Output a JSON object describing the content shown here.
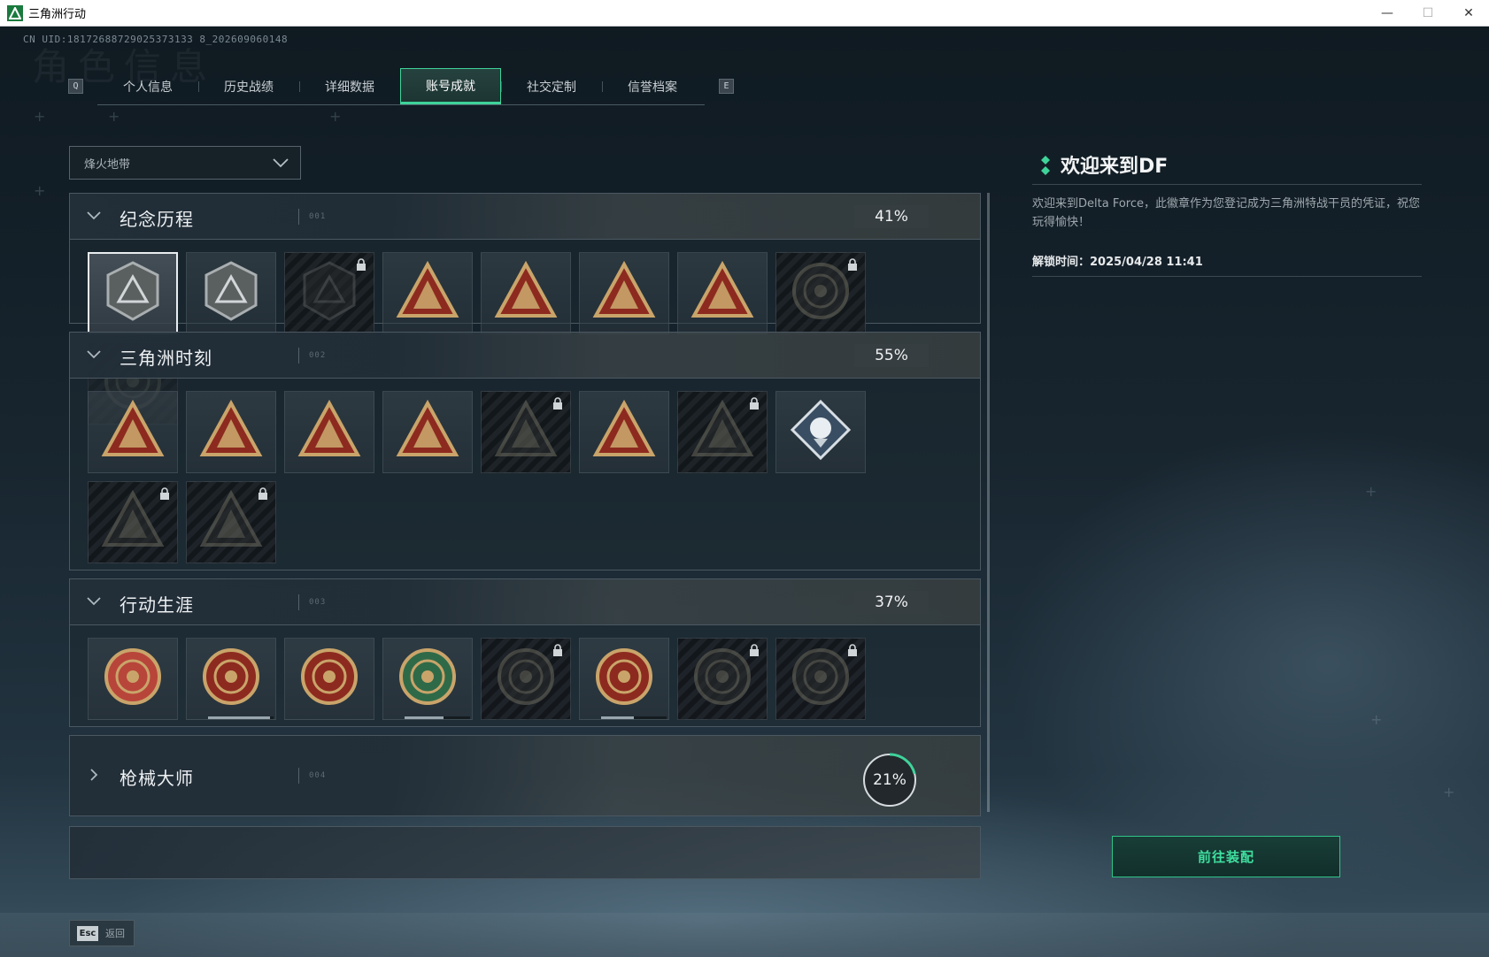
{
  "window": {
    "title": "三角洲行动",
    "minimize": "—",
    "maximize": "☐",
    "close": "✕"
  },
  "header": {
    "uid": "CN UID:18172688729025373133 8_202609060148",
    "ghost_title": "角色信息"
  },
  "tabs": {
    "prev_key": "Q",
    "next_key": "E",
    "items": [
      {
        "label": "个人信息",
        "active": false
      },
      {
        "label": "历史战绩",
        "active": false
      },
      {
        "label": "详细数据",
        "active": false
      },
      {
        "label": "账号成就",
        "active": true
      },
      {
        "label": "社交定制",
        "active": false
      },
      {
        "label": "信誉档案",
        "active": false
      }
    ]
  },
  "mode_select": {
    "value": "烽火地带"
  },
  "categories": [
    {
      "title": "纪念历程",
      "dots": "001",
      "percent": "41%",
      "expanded": true,
      "badges": [
        {
          "icon": "delta-emblem-icon",
          "locked": false,
          "selected": true
        },
        {
          "icon": "helicopter-emblem-icon",
          "locked": false
        },
        {
          "icon": "shield-emblem-icon",
          "locked": true
        },
        {
          "icon": "tower-58-emblem-icon",
          "locked": false
        },
        {
          "icon": "boat-emblem-icon",
          "locked": false
        },
        {
          "icon": "number-1-emblem-icon",
          "locked": false
        },
        {
          "icon": "number-2-emblem-icon",
          "locked": false
        },
        {
          "icon": "round-seal-emblem-icon",
          "locked": true
        },
        {
          "icon": "round-seal-emblem-icon",
          "locked": true
        }
      ]
    },
    {
      "title": "三角洲时刻",
      "dots": "002",
      "percent": "55%",
      "expanded": true,
      "badges": [
        {
          "icon": "box-emblem-icon",
          "locked": false
        },
        {
          "icon": "soldier-emblem-icon",
          "locked": false
        },
        {
          "icon": "hands-emblem-icon",
          "locked": false
        },
        {
          "icon": "squad-emblem-icon",
          "locked": false
        },
        {
          "icon": "squad-emblem-icon",
          "locked": true
        },
        {
          "icon": "rocket-emblem-icon",
          "locked": false
        },
        {
          "icon": "dragon-emblem-icon",
          "locked": true
        },
        {
          "icon": "rose-diamond-emblem-icon",
          "locked": false
        },
        {
          "icon": "tiger-emblem-icon",
          "locked": true
        },
        {
          "icon": "skull-emblem-icon",
          "locked": true
        }
      ]
    },
    {
      "title": "行动生涯",
      "dots": "003",
      "percent": "37%",
      "expanded": true,
      "badges": [
        {
          "icon": "star-medal-icon",
          "locked": false
        },
        {
          "icon": "shield-medal-icon",
          "locked": false,
          "progress": 0.95
        },
        {
          "icon": "eagle-medal-icon",
          "locked": false
        },
        {
          "icon": "green-shield-medal-icon",
          "locked": false,
          "progress": 0.6
        },
        {
          "icon": "helmet-medal-icon",
          "locked": true
        },
        {
          "icon": "skull-target-medal-icon",
          "locked": false,
          "progress": 0.5
        },
        {
          "icon": "eye-medal-icon",
          "locked": true
        },
        {
          "icon": "wolf-medal-icon",
          "locked": true
        }
      ]
    },
    {
      "title": "枪械大师",
      "dots": "004",
      "percent": "21%",
      "progress": 0.21,
      "expanded": false
    }
  ],
  "detail": {
    "title": "欢迎来到DF",
    "description": "欢迎来到Delta Force，此徽章作为您登记成为三角洲特战干员的凭证，祝您玩得愉快！",
    "unlock_time": "解锁时间：2025/04/28 11:41"
  },
  "actions": {
    "equip_button": "前往装配",
    "esc_key": "Esc",
    "back_label": "返回"
  },
  "colors": {
    "accent": "#3fd39a",
    "badge_gold": "#c9a46a",
    "badge_red": "#8d2a1f"
  }
}
